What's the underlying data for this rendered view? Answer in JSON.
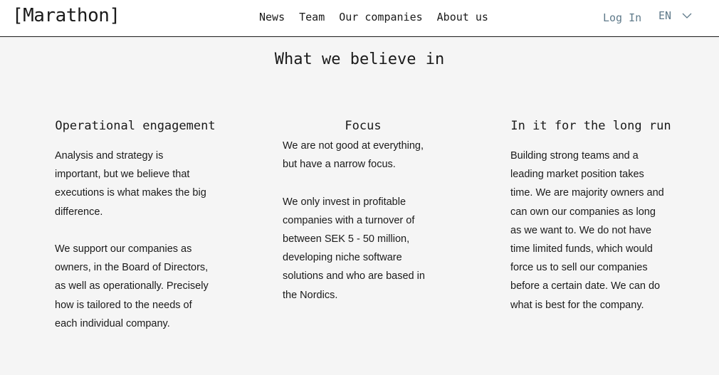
{
  "header": {
    "logo": "[Marathon]",
    "nav": [
      "News",
      "Team",
      "Our companies",
      "About us"
    ],
    "login": "Log In",
    "language": "EN"
  },
  "main": {
    "title": "What we believe in",
    "columns": [
      {
        "heading": "Operational engagement",
        "paragraphs": [
          "Analysis and strategy is important, but we believe that executions is what makes the big difference.",
          "We support our companies as owners, in the Board of Directors, as well as operationally. Precisely how is tailored to the needs of each individual company."
        ]
      },
      {
        "heading": "Focus",
        "paragraphs": [
          "We are not good at everything, but have a narrow focus.",
          "We only invest in profitable companies with a turnover of between SEK 5 - 50 million, developing niche software solutions and who are based in the Nordics."
        ]
      },
      {
        "heading": "In it for the long run",
        "paragraphs": [
          "Building strong teams and a leading market position takes time. We are majority owners and can own our companies as long as we want to. We do not have time limited funds, which would force us to sell our companies before a certain date. We can do what is best for the company."
        ]
      }
    ]
  },
  "colors": {
    "background": "#f5f5f5",
    "header_background": "#ffffff",
    "text": "#1a1a1a",
    "accent": "#5f7a8a"
  },
  "icons": {
    "language_toggle": "chevron-down-icon"
  }
}
